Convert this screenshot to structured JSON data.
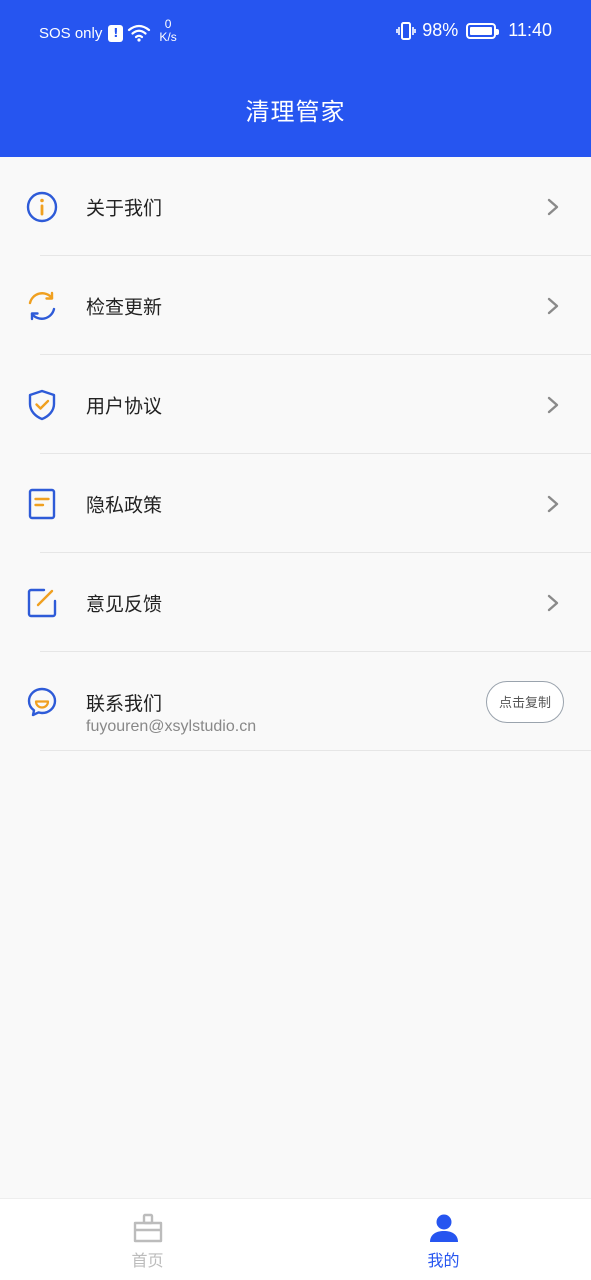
{
  "status_bar": {
    "carrier": "SOS only",
    "alert": "!",
    "network_speed_value": "0",
    "network_speed_unit": "K/s",
    "battery_percent": "98%",
    "battery_level": 0.98,
    "time": "11:40"
  },
  "header": {
    "title": "清理管家"
  },
  "menu": {
    "items": [
      {
        "label": "关于我们",
        "icon": "info-icon"
      },
      {
        "label": "检查更新",
        "icon": "refresh-icon"
      },
      {
        "label": "用户协议",
        "icon": "shield-check-icon"
      },
      {
        "label": "隐私政策",
        "icon": "document-icon"
      },
      {
        "label": "意见反馈",
        "icon": "edit-icon"
      }
    ],
    "contact": {
      "label": "联系我们",
      "email": "fuyouren@xsylstudio.cn",
      "copy_label": "点击复制",
      "icon": "chat-smile-icon"
    }
  },
  "bottom_nav": {
    "home_label": "首页",
    "mine_label": "我的"
  },
  "colors": {
    "primary": "#2655f0",
    "accent": "#f0a020",
    "icon_blue": "#2e5bd8",
    "inactive": "#bcbcbc"
  }
}
